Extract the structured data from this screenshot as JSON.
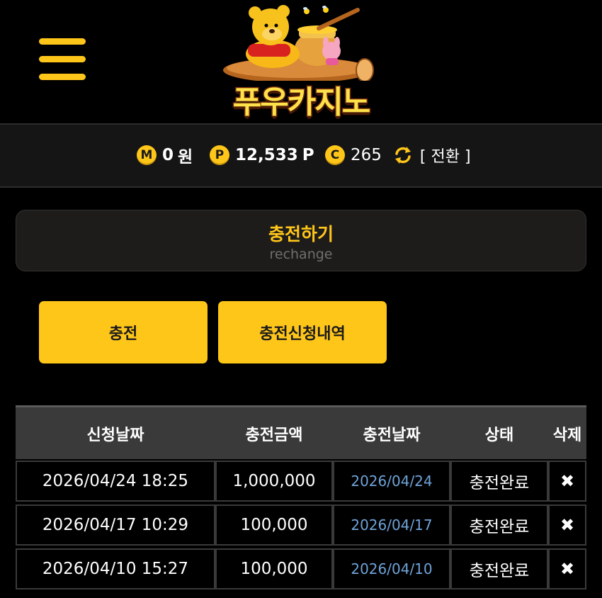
{
  "header": {
    "logo_text": "푸우카지노",
    "menu_icon": "hamburger-menu-icon"
  },
  "balances": {
    "money": {
      "badge": "M",
      "value": "0",
      "unit": "원"
    },
    "point": {
      "badge": "P",
      "value": "12,533",
      "unit": "P"
    },
    "coin": {
      "badge": "C",
      "value": "265"
    },
    "refresh_icon": "refresh-icon",
    "convert_label": "[ 전환 ]"
  },
  "section": {
    "title": "충전하기",
    "subtitle": "rechange"
  },
  "buttons": {
    "charge": "충전",
    "history": "충전신청내역"
  },
  "table": {
    "headers": [
      "신청날짜",
      "충전금액",
      "충전날짜",
      "상태",
      "삭제"
    ],
    "rows": [
      {
        "requested": "2026/04/24 18:25",
        "amount": "1,000,000",
        "charged": "2026/04/24",
        "status": "충전완료",
        "delete": "✖"
      },
      {
        "requested": "2026/04/17 10:29",
        "amount": "100,000",
        "charged": "2026/04/17",
        "status": "충전완료",
        "delete": "✖"
      },
      {
        "requested": "2026/04/10 15:27",
        "amount": "100,000",
        "charged": "2026/04/10",
        "status": "충전완료",
        "delete": "✖"
      }
    ]
  },
  "colors": {
    "accent": "#FFC61A",
    "background": "#000000",
    "date_link": "#6fa3d8"
  }
}
